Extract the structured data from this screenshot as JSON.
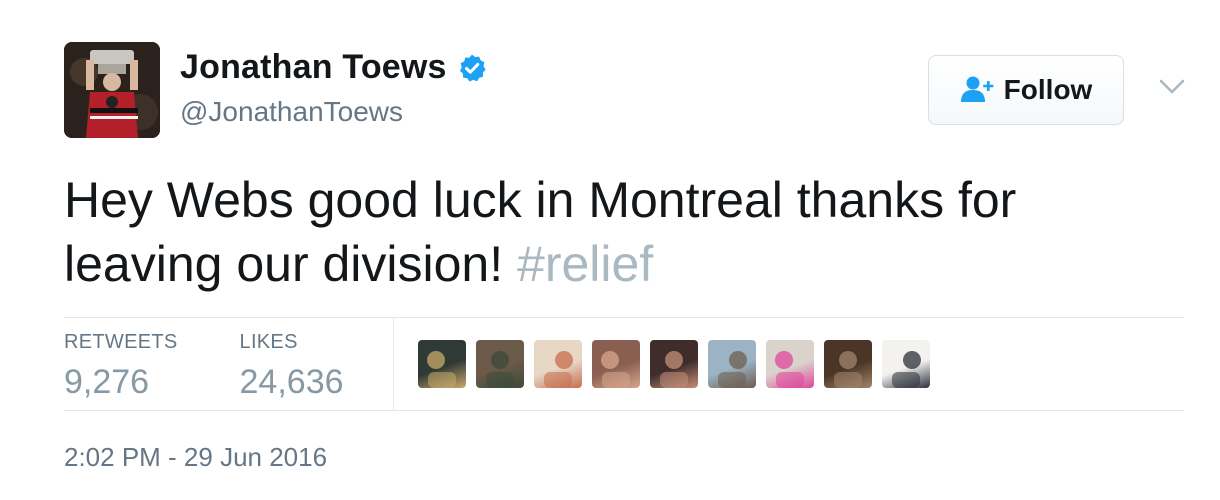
{
  "user": {
    "name": "Jonathan Toews",
    "handle": "@JonathanToews",
    "verified": true,
    "avatar": "avatar-photo-holding-trophy"
  },
  "follow_button": {
    "label": "Follow",
    "icon": "add-user-icon"
  },
  "tweet": {
    "text": "Hey Webs good luck in Montreal thanks for leaving our division! ",
    "hashtag": "#relief"
  },
  "stats": {
    "retweets": {
      "label": "RETWEETS",
      "value": "9,276"
    },
    "likes": {
      "label": "LIKES",
      "value": "24,636"
    }
  },
  "likers": [
    {
      "color": "#2f3a36",
      "accent": "#c9a96b"
    },
    {
      "color": "#6b5a4a",
      "accent": "#3d4a3a"
    },
    {
      "color": "#e7d8c6",
      "accent": "#c76e4c"
    },
    {
      "color": "#8a5f52",
      "accent": "#d7a58c"
    },
    {
      "color": "#3e2d2a",
      "accent": "#c78f7a"
    },
    {
      "color": "#9bb3c5",
      "accent": "#6c5d4d"
    },
    {
      "color": "#d9d3cb",
      "accent": "#e0449a"
    },
    {
      "color": "#4a3526",
      "accent": "#a2856b"
    },
    {
      "color": "#f4f2ee",
      "accent": "#2c2f3a"
    }
  ],
  "timestamp": "2:02 PM - 29 Jun 2016",
  "colors": {
    "verified_badge": "#1da1f2",
    "hashtag": "#aab8c2",
    "secondary_text": "#657786"
  }
}
